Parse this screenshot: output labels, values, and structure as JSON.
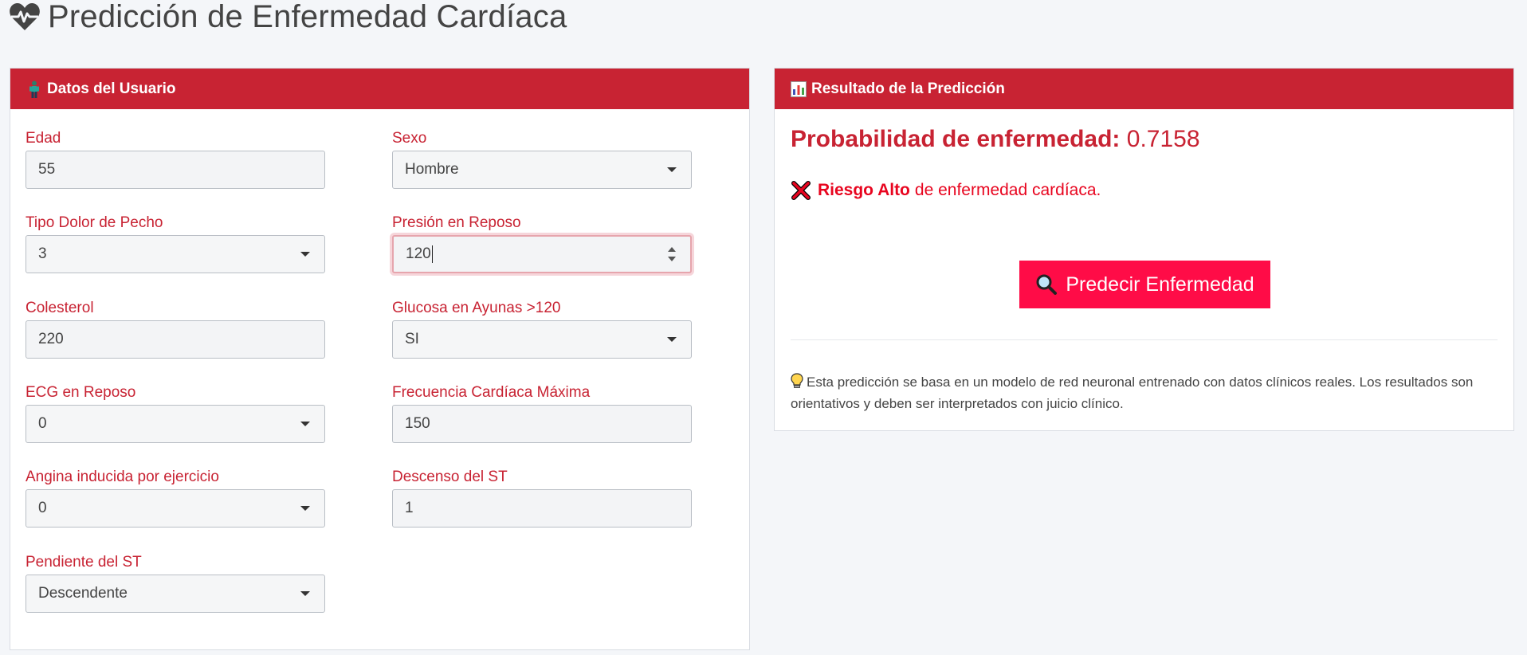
{
  "page": {
    "title": "Predicción de Enfermedad Cardíaca",
    "title_icon": "heart-pulse-icon"
  },
  "user_panel": {
    "header": "Datos del Usuario",
    "header_icon": "person-icon",
    "fields": {
      "edad": {
        "label": "Edad",
        "value": "55"
      },
      "sexo": {
        "label": "Sexo",
        "value": "Hombre"
      },
      "tipo_dolor": {
        "label": "Tipo Dolor de Pecho",
        "value": "3"
      },
      "presion": {
        "label": "Presión en Reposo",
        "value": "120"
      },
      "colesterol": {
        "label": "Colesterol",
        "value": "220"
      },
      "glucosa": {
        "label": "Glucosa en Ayunas >120",
        "value": "SI"
      },
      "ecg": {
        "label": "ECG en Reposo",
        "value": "0"
      },
      "frecuencia": {
        "label": "Frecuencia Cardíaca Máxima",
        "value": "150"
      },
      "angina": {
        "label": "Angina inducida por ejercicio",
        "value": "0"
      },
      "descenso": {
        "label": "Descenso del ST",
        "value": "1"
      },
      "pendiente": {
        "label": "Pendiente del ST",
        "value": "Descendente"
      }
    }
  },
  "result_panel": {
    "header": "Resultado de la Predicción",
    "header_icon": "bar-chart-icon",
    "probability_label": "Probabilidad de enfermedad:",
    "probability_value": "0.7158",
    "risk_icon": "cross-mark-icon",
    "risk_strong": "Riesgo Alto",
    "risk_text": "de enfermedad cardíaca.",
    "predict_button": "Predecir Enfermedad",
    "predict_icon": "magnifier-icon",
    "note_icon": "light-bulb-icon",
    "note": "Esta predicción se basa en un modelo de red neuronal entrenado con datos clínicos reales. Los resultados son orientativos y deben ser interpretados con juicio clínico."
  },
  "colors": {
    "header_red": "#c82333",
    "label_red": "#c82333",
    "button_red": "#ff0c47",
    "risk_red": "#e8051f"
  }
}
